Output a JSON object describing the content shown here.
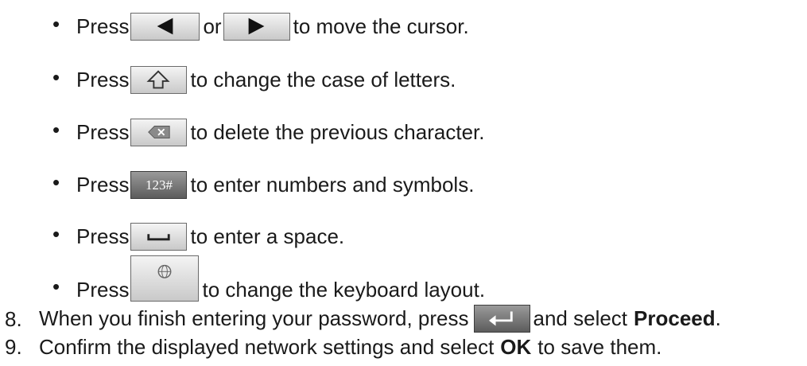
{
  "bullets": [
    {
      "prefix": "Press",
      "mid": "or",
      "suffix": "to move the cursor.",
      "icons": [
        "left-arrow-icon",
        "right-arrow-icon"
      ]
    },
    {
      "prefix": "Press",
      "suffix": "to change the case of letters.",
      "icons": [
        "shift-icon"
      ]
    },
    {
      "prefix": "Press",
      "suffix": "to delete the previous character.",
      "icons": [
        "delete-icon"
      ]
    },
    {
      "prefix": "Press",
      "suffix": "to enter numbers and symbols.",
      "icons": [
        "numbers-symbols-icon"
      ],
      "icon_text": "123#"
    },
    {
      "prefix": "Press",
      "suffix": "to enter a space.",
      "icons": [
        "space-icon"
      ]
    },
    {
      "prefix": "Press",
      "suffix": "to change the keyboard layout.",
      "icons": [
        "globe-icon"
      ]
    }
  ],
  "bullet_char": "•",
  "steps": [
    {
      "number": "8.",
      "text_before": "When you finish entering your password, press",
      "text_mid": "and select",
      "bold": "Proceed",
      "text_after": "."
    },
    {
      "number": "9.",
      "text_before": "Confirm the displayed network settings and select",
      "bold": "OK",
      "text_after": "to save them."
    }
  ]
}
